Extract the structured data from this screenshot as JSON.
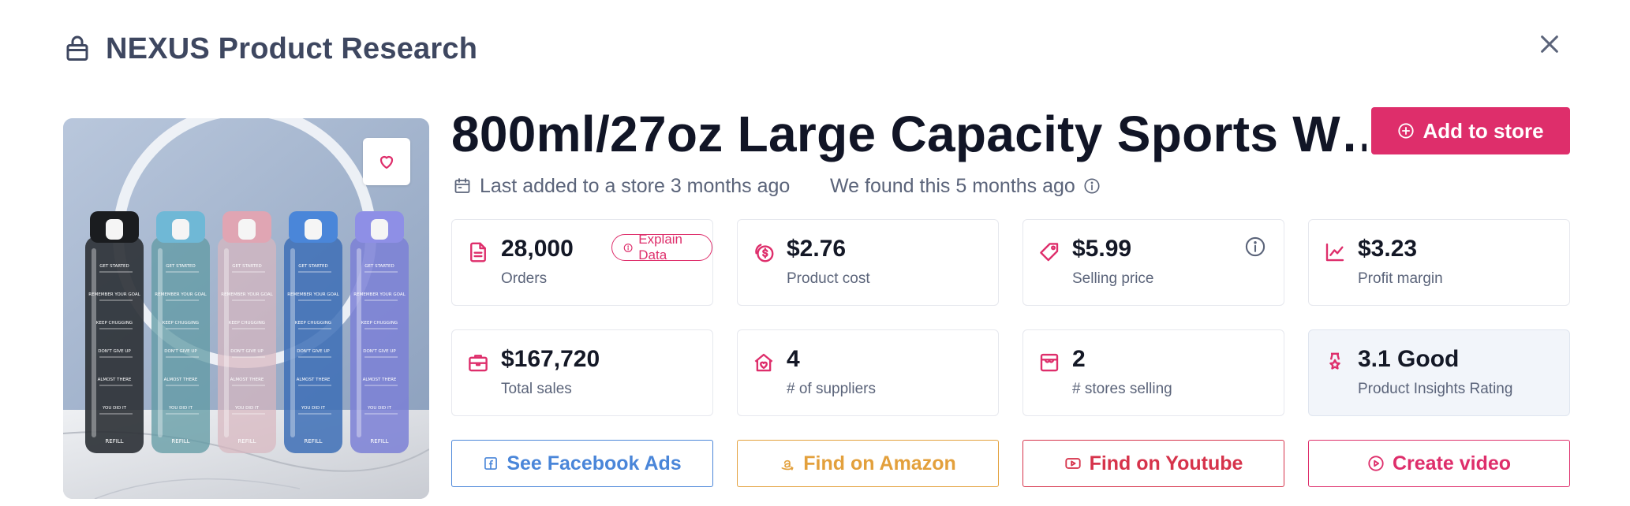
{
  "header": {
    "title": "NEXUS Product Research",
    "icon": "shopping-bag-icon"
  },
  "product": {
    "title": "800ml/27oz Large Capacity Sports W…",
    "add_button_label": "Add to store",
    "last_added": "Last added to a store 3 months ago",
    "found": "We found this 5 months ago"
  },
  "explain_label": "Explain Data",
  "stats": [
    {
      "value": "28,000",
      "label": "Orders",
      "icon": "document-icon"
    },
    {
      "value": "$2.76",
      "label": "Product cost",
      "icon": "coins-icon"
    },
    {
      "value": "$5.99",
      "label": "Selling price",
      "icon": "price-tag-icon"
    },
    {
      "value": "$3.23",
      "label": "Profit margin",
      "icon": "trend-chart-icon"
    },
    {
      "value": "$167,720",
      "label": "Total sales",
      "icon": "briefcase-icon"
    },
    {
      "value": "4",
      "label": "# of suppliers",
      "icon": "supplier-house-icon"
    },
    {
      "value": "2",
      "label": "# stores selling",
      "icon": "storefront-icon"
    },
    {
      "value": "3.1 Good",
      "label": "Product Insights Rating",
      "icon": "award-ribbon-icon"
    }
  ],
  "actions": {
    "facebook": "See Facebook Ads",
    "amazon": "Find on Amazon",
    "youtube": "Find on Youtube",
    "video": "Create video"
  },
  "bottle_labels": [
    "8AM",
    "2PM",
    "GET STARTED",
    "9AM",
    "3PM",
    "REMEMBER YOUR GOAL",
    "10AM",
    "4PM",
    "KEEP CHUGGING",
    "11AM",
    "5PM",
    "DON'T GIVE UP",
    "12PM",
    "6PM",
    "ALMOST THERE",
    "1PM",
    "7PM",
    "YOU DID IT",
    "REFILL"
  ],
  "colors": {
    "accent": "#de2e6b",
    "facebook": "#4a86d9",
    "amazon": "#e3a03c",
    "youtube": "#d6334b",
    "text_muted": "#5b647a",
    "header_text": "#3e4760"
  }
}
